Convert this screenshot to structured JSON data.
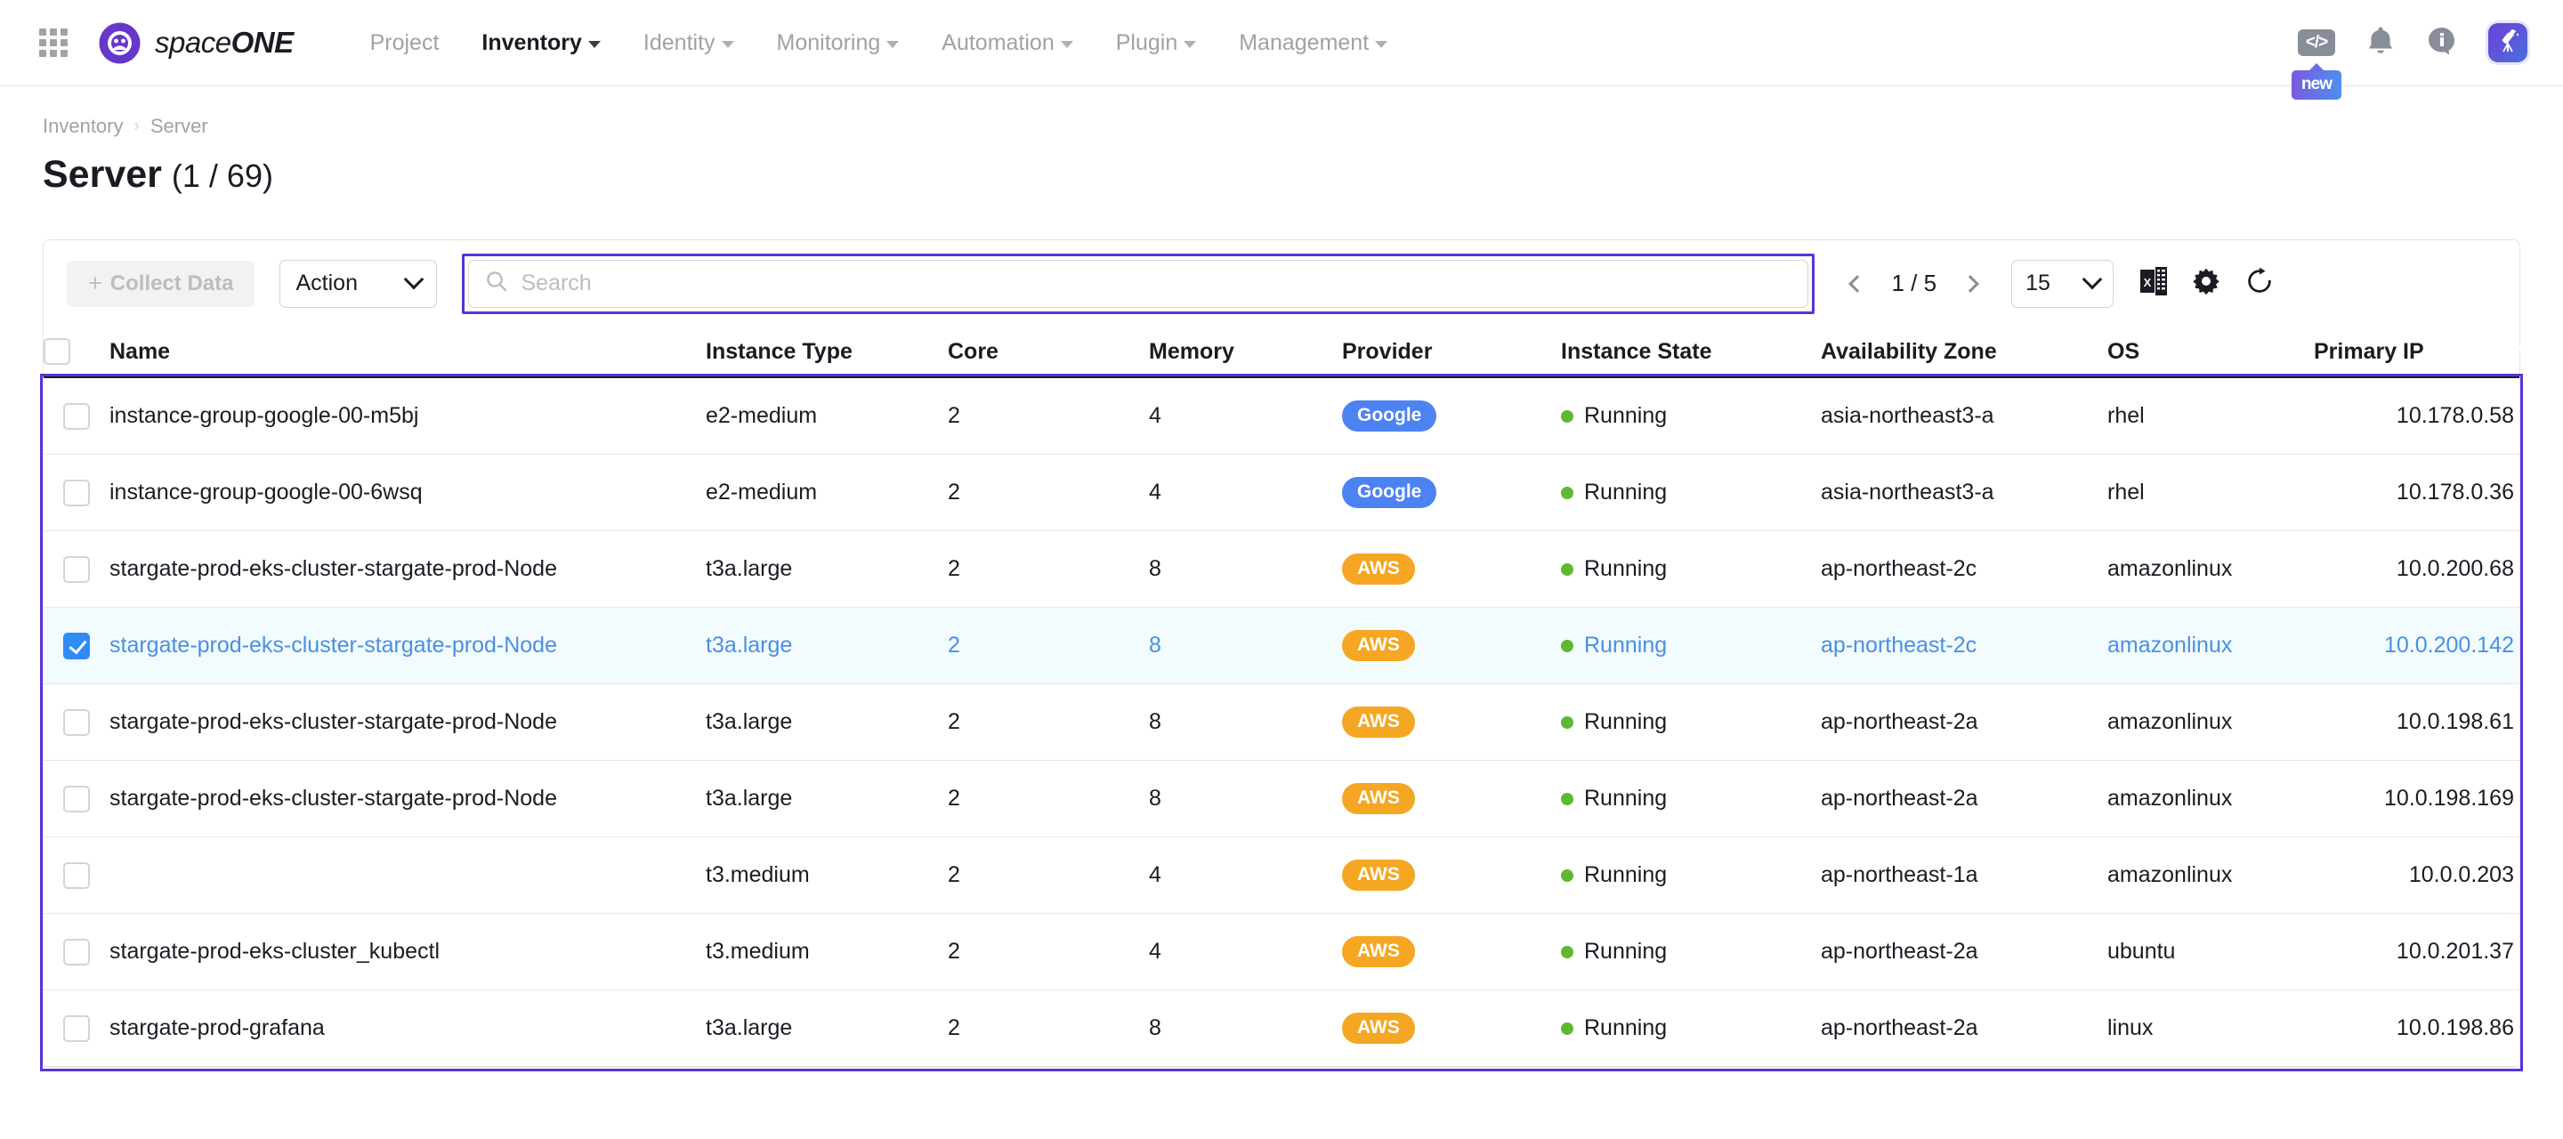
{
  "nav": {
    "apps_icon": "apps-grid-icon",
    "brand_light": "space",
    "brand_bold": "ONE",
    "menu": [
      {
        "label": "Project",
        "has_caret": false,
        "active": false
      },
      {
        "label": "Inventory",
        "has_caret": true,
        "active": true
      },
      {
        "label": "Identity",
        "has_caret": true,
        "active": false
      },
      {
        "label": "Monitoring",
        "has_caret": true,
        "active": false
      },
      {
        "label": "Automation",
        "has_caret": true,
        "active": false
      },
      {
        "label": "Plugin",
        "has_caret": true,
        "active": false
      },
      {
        "label": "Management",
        "has_caret": true,
        "active": false
      }
    ],
    "code_icon_label": "</>",
    "new_tooltip": "new",
    "bell_icon": "bell-icon",
    "info_icon": "info-icon",
    "avatar_icon": "telescope-icon"
  },
  "breadcrumb": {
    "parent": "Inventory",
    "separator": "›",
    "current": "Server"
  },
  "page": {
    "title": "Server",
    "count": "(1 / 69)"
  },
  "toolbar": {
    "collect_label": "Collect Data",
    "collect_plus": "+",
    "action_label": "Action",
    "search_placeholder": "Search",
    "search_value": "",
    "page_indicator": "1 / 5",
    "page_size": "15",
    "excel_icon": "excel-export-icon",
    "settings_icon": "gear-icon",
    "refresh_icon": "refresh-icon",
    "prev_icon": "chevron-left-icon",
    "next_icon": "chevron-right-icon"
  },
  "colors": {
    "accent": "#5a32d8",
    "selected_row_bg": "#f2fbfd",
    "selected_text": "#4a90e2",
    "google_badge": "#4d82f3",
    "aws_badge": "#f5a623",
    "running_dot": "#60b832"
  },
  "table": {
    "columns": [
      {
        "key": "name",
        "label": "Name"
      },
      {
        "key": "type",
        "label": "Instance Type"
      },
      {
        "key": "core",
        "label": "Core"
      },
      {
        "key": "mem",
        "label": "Memory"
      },
      {
        "key": "prov",
        "label": "Provider"
      },
      {
        "key": "state",
        "label": "Instance State"
      },
      {
        "key": "az",
        "label": "Availability Zone"
      },
      {
        "key": "os",
        "label": "OS"
      },
      {
        "key": "ip",
        "label": "Primary IP"
      }
    ],
    "rows": [
      {
        "selected": false,
        "name": "instance-group-google-00-m5bj",
        "type": "e2-medium",
        "core": "2",
        "mem": "4",
        "provider": "Google",
        "provider_kind": "google",
        "state": "Running",
        "az": "asia-northeast3-a",
        "os": "rhel",
        "ip": "10.178.0.58"
      },
      {
        "selected": false,
        "name": "instance-group-google-00-6wsq",
        "type": "e2-medium",
        "core": "2",
        "mem": "4",
        "provider": "Google",
        "provider_kind": "google",
        "state": "Running",
        "az": "asia-northeast3-a",
        "os": "rhel",
        "ip": "10.178.0.36"
      },
      {
        "selected": false,
        "name": "stargate-prod-eks-cluster-stargate-prod-Node",
        "type": "t3a.large",
        "core": "2",
        "mem": "8",
        "provider": "AWS",
        "provider_kind": "aws",
        "state": "Running",
        "az": "ap-northeast-2c",
        "os": "amazonlinux",
        "ip": "10.0.200.68"
      },
      {
        "selected": true,
        "name": "stargate-prod-eks-cluster-stargate-prod-Node",
        "type": "t3a.large",
        "core": "2",
        "mem": "8",
        "provider": "AWS",
        "provider_kind": "aws",
        "state": "Running",
        "az": "ap-northeast-2c",
        "os": "amazonlinux",
        "ip": "10.0.200.142"
      },
      {
        "selected": false,
        "name": "stargate-prod-eks-cluster-stargate-prod-Node",
        "type": "t3a.large",
        "core": "2",
        "mem": "8",
        "provider": "AWS",
        "provider_kind": "aws",
        "state": "Running",
        "az": "ap-northeast-2a",
        "os": "amazonlinux",
        "ip": "10.0.198.61"
      },
      {
        "selected": false,
        "name": "stargate-prod-eks-cluster-stargate-prod-Node",
        "type": "t3a.large",
        "core": "2",
        "mem": "8",
        "provider": "AWS",
        "provider_kind": "aws",
        "state": "Running",
        "az": "ap-northeast-2a",
        "os": "amazonlinux",
        "ip": "10.0.198.169"
      },
      {
        "selected": false,
        "name": "",
        "type": "t3.medium",
        "core": "2",
        "mem": "4",
        "provider": "AWS",
        "provider_kind": "aws",
        "state": "Running",
        "az": "ap-northeast-1a",
        "os": "amazonlinux",
        "ip": "10.0.0.203"
      },
      {
        "selected": false,
        "name": "stargate-prod-eks-cluster_kubectl",
        "type": "t3.medium",
        "core": "2",
        "mem": "4",
        "provider": "AWS",
        "provider_kind": "aws",
        "state": "Running",
        "az": "ap-northeast-2a",
        "os": "ubuntu",
        "ip": "10.0.201.37"
      },
      {
        "selected": false,
        "name": "stargate-prod-grafana",
        "type": "t3a.large",
        "core": "2",
        "mem": "8",
        "provider": "AWS",
        "provider_kind": "aws",
        "state": "Running",
        "az": "ap-northeast-2a",
        "os": "linux",
        "ip": "10.0.198.86"
      }
    ]
  }
}
